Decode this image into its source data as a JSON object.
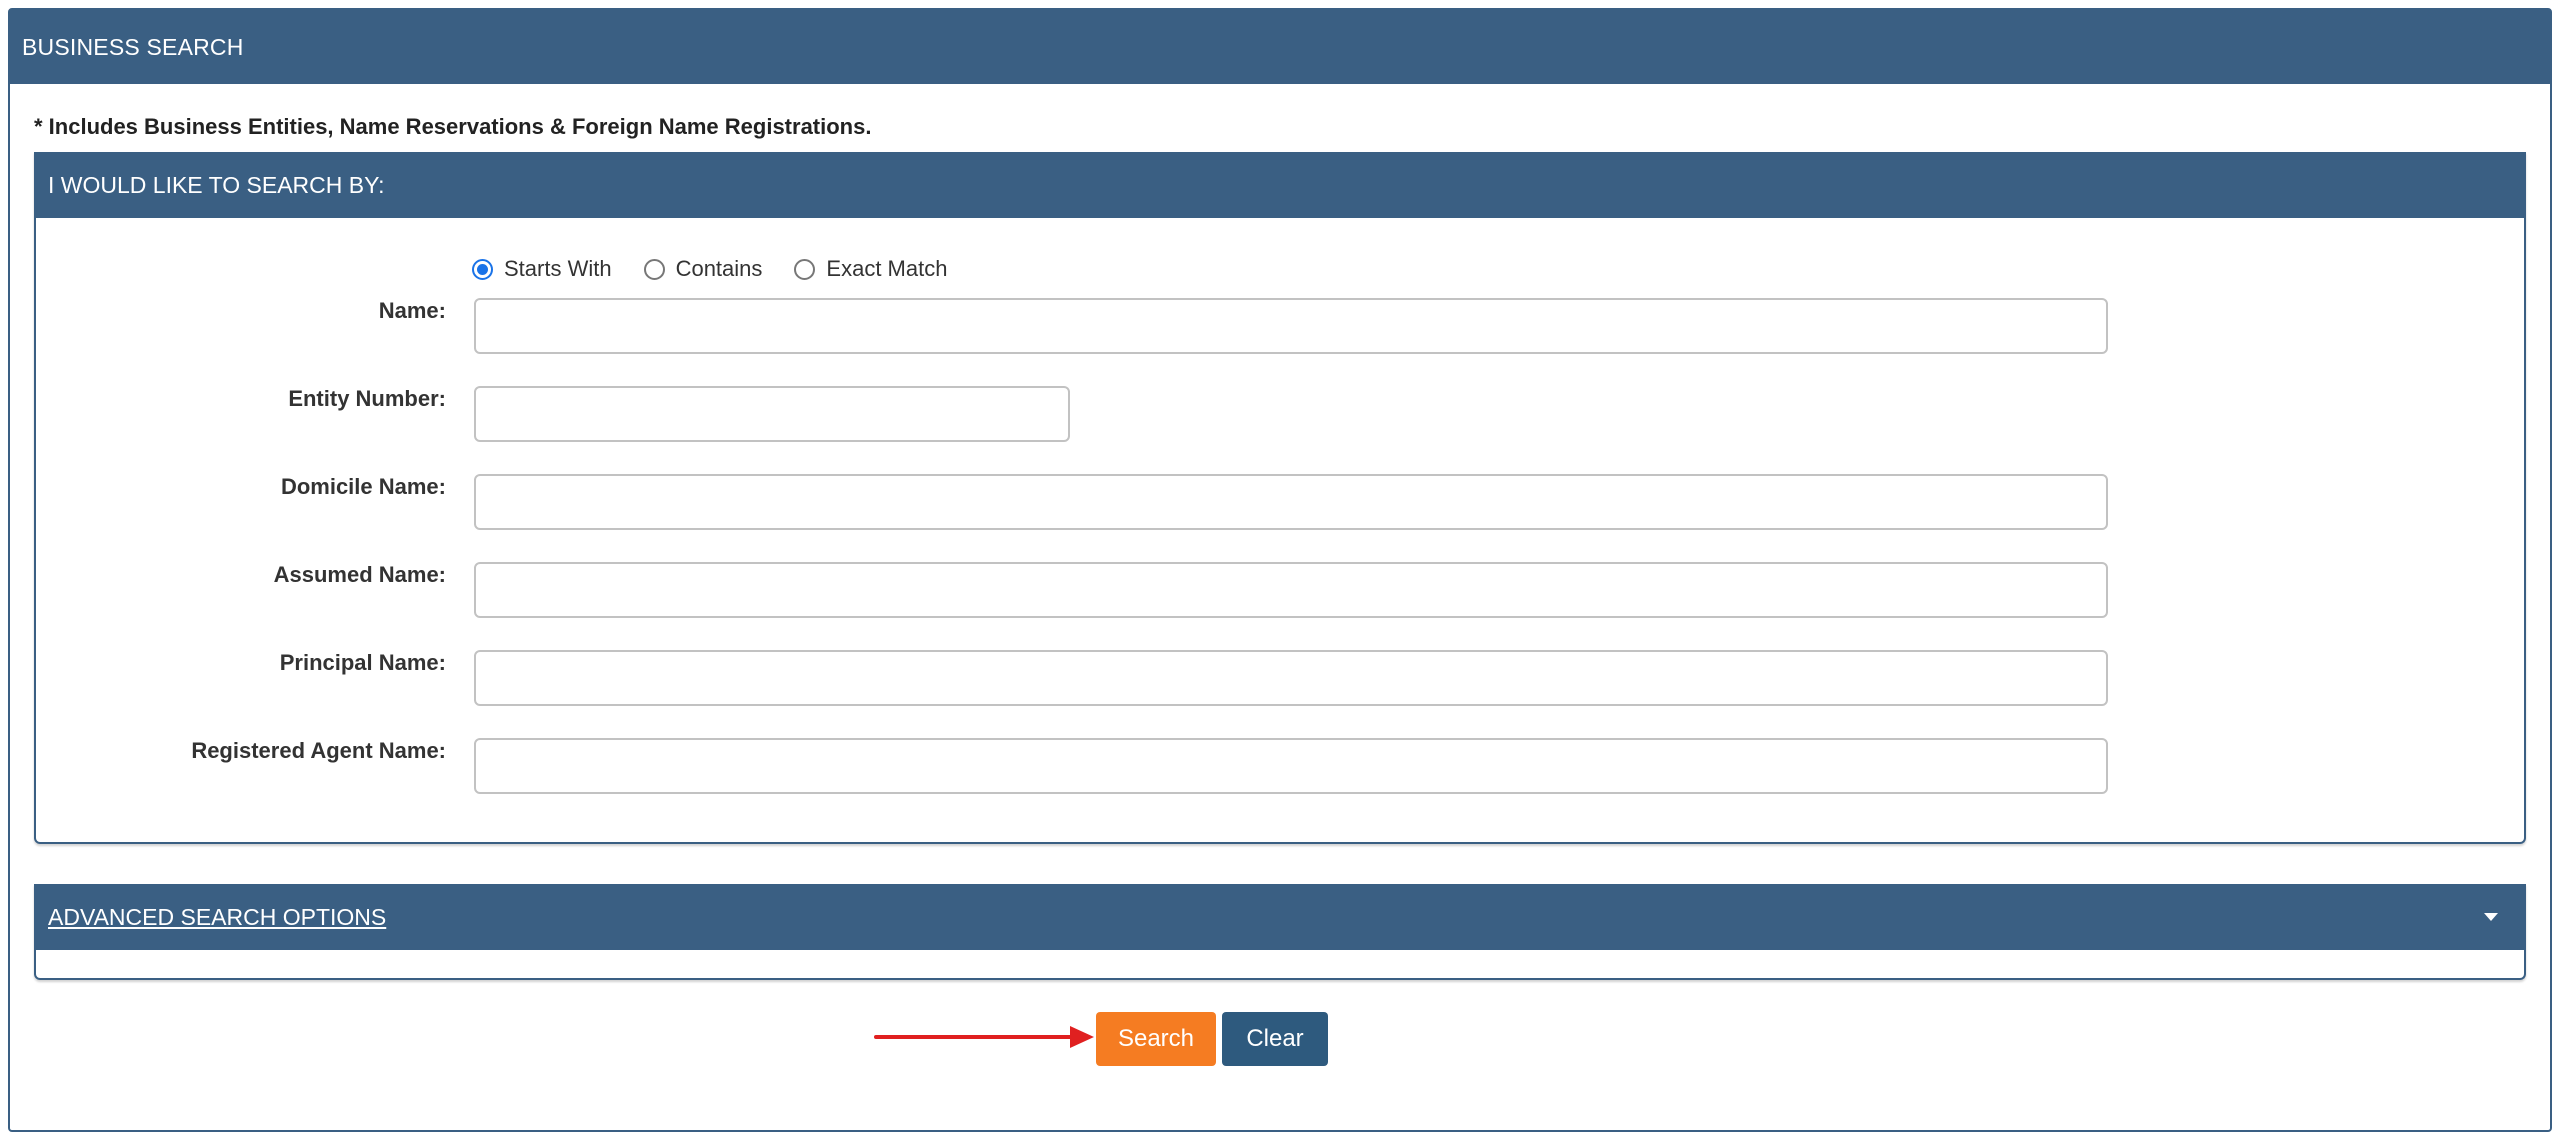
{
  "header": {
    "title": "BUSINESS SEARCH"
  },
  "note": "* Includes Business Entities, Name Reservations & Foreign Name Registrations.",
  "search_panel": {
    "title": "I WOULD LIKE TO SEARCH BY:",
    "match_options": [
      {
        "label": "Starts With",
        "selected": true
      },
      {
        "label": "Contains",
        "selected": false
      },
      {
        "label": "Exact Match",
        "selected": false
      }
    ],
    "fields": {
      "name": {
        "label": "Name:",
        "value": ""
      },
      "entity_number": {
        "label": "Entity Number:",
        "value": ""
      },
      "domicile_name": {
        "label": "Domicile Name:",
        "value": ""
      },
      "assumed_name": {
        "label": "Assumed Name:",
        "value": ""
      },
      "principal_name": {
        "label": "Principal Name:",
        "value": ""
      },
      "registered_agent_name": {
        "label": "Registered Agent Name:",
        "value": ""
      }
    }
  },
  "advanced": {
    "title": "ADVANCED SEARCH OPTIONS",
    "icon": "caret-down-icon"
  },
  "buttons": {
    "search": "Search",
    "clear": "Clear"
  },
  "colors": {
    "header": "#3a5f83",
    "search_button": "#f57c22",
    "clear_button": "#2e5a7e",
    "annotation_arrow": "#e02020"
  }
}
